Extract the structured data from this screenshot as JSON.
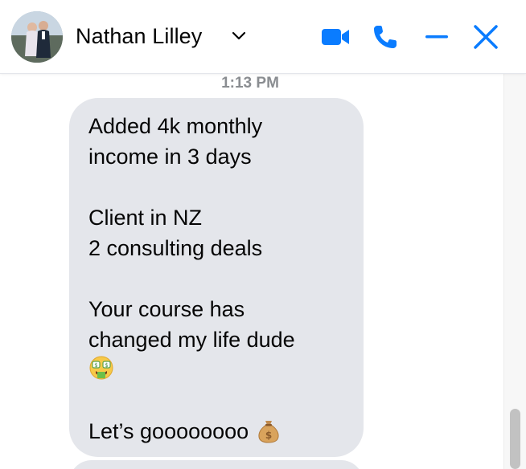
{
  "header": {
    "contact_name": "Nathan Lilley",
    "icons": {
      "avatar": "profile-photo",
      "dropdown": "chevron-down-icon",
      "video": "video-camera-icon",
      "call": "phone-icon",
      "minimize": "minimize-icon",
      "close": "close-icon"
    },
    "accent_color": "#0a7cff"
  },
  "conversation": {
    "timestamp": "1:13 PM",
    "message": {
      "lines": [
        "Added 4k monthly",
        "income in 3 days",
        "",
        "Client in NZ",
        "2 consulting deals",
        "",
        "Your course has",
        "changed my life dude",
        "",
        "",
        "Let’s goooooooo"
      ],
      "emojis": [
        "money-mouth-face-emoji",
        "money-bag-emoji"
      ]
    },
    "bubble_color": "#e4e6eb"
  }
}
